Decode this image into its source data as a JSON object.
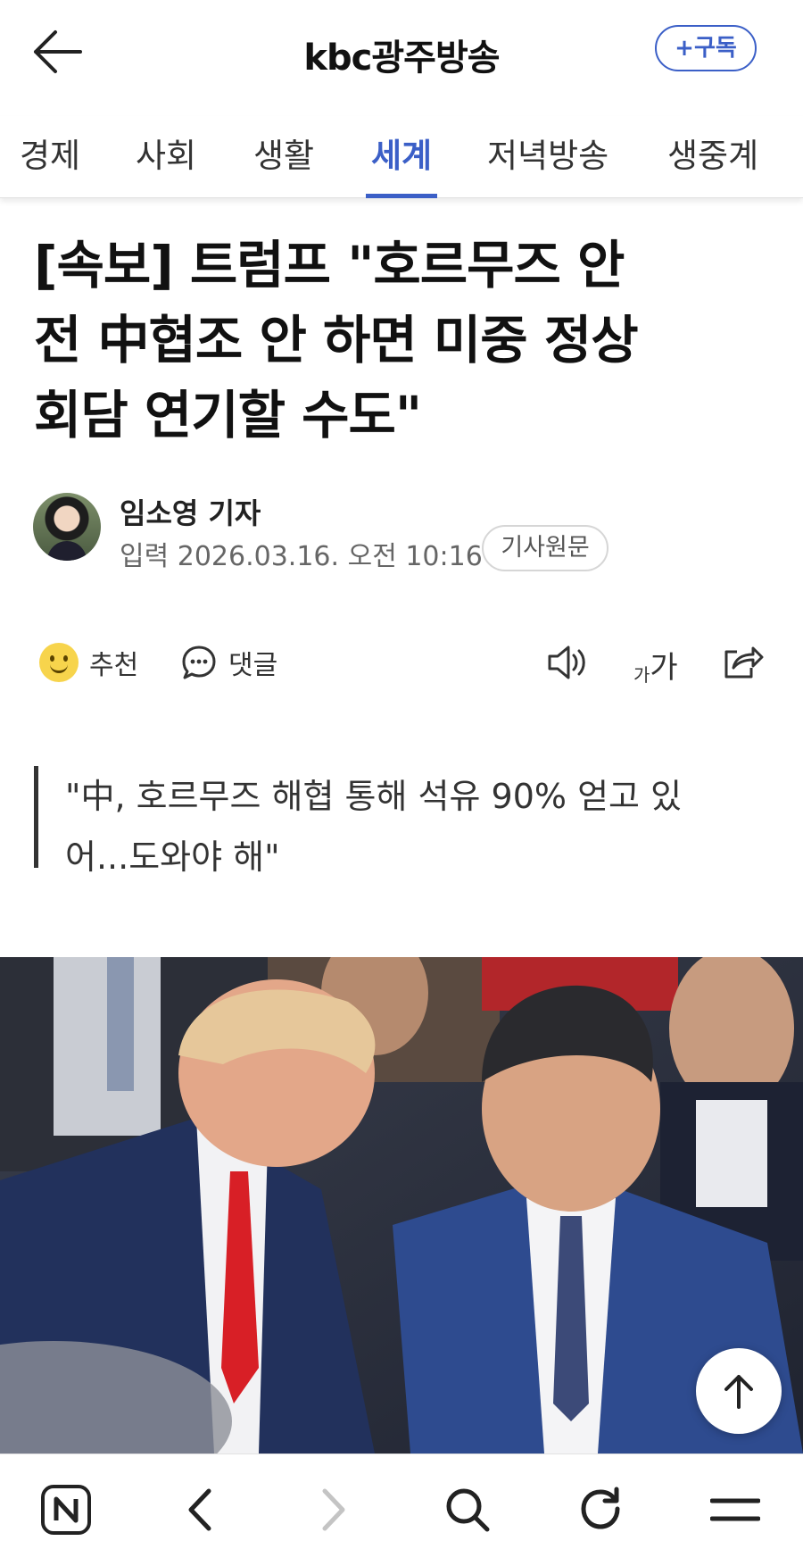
{
  "header": {
    "brand": "kbc광주방송",
    "subscribe_label": "+구독"
  },
  "tabs": [
    {
      "label": "경제"
    },
    {
      "label": "사회"
    },
    {
      "label": "생활"
    },
    {
      "label": "세계",
      "active": true
    },
    {
      "label": "저녁방송"
    },
    {
      "label": "생중계"
    }
  ],
  "article": {
    "title_lines": [
      "[속보] 트럼프 \"호르무즈 안",
      "전 中협조 안 하면 미중 정상",
      "회담 연기할 수도\""
    ],
    "reporter": "임소영 기자",
    "published_label": "입력",
    "published_date": "2026.03.16. 오전 10:16",
    "source_button": "기사원문",
    "quote_lines": [
      "\"中, 호르무즈 해협 통해 석유 90% 얻고 있",
      "어...도와야 해\""
    ]
  },
  "actions": {
    "recommend_label": "추천",
    "comment_label": "댓글",
    "font_small": "가",
    "font_large": "가"
  },
  "icons": {
    "back": "back-arrow-icon",
    "smiley": "smiley-icon",
    "comment": "speech-bubble-icon",
    "audio": "speaker-icon",
    "font": "font-size-icon",
    "share": "share-icon",
    "scroll_top": "arrow-up-icon",
    "naver": "naver-n-icon",
    "nav_back": "chevron-left-icon",
    "nav_forward": "chevron-right-icon",
    "search": "search-icon",
    "reload": "reload-icon",
    "menu": "menu-icon"
  },
  "colors": {
    "accent": "#3b5fc7",
    "text": "#111111",
    "muted": "#666666"
  }
}
